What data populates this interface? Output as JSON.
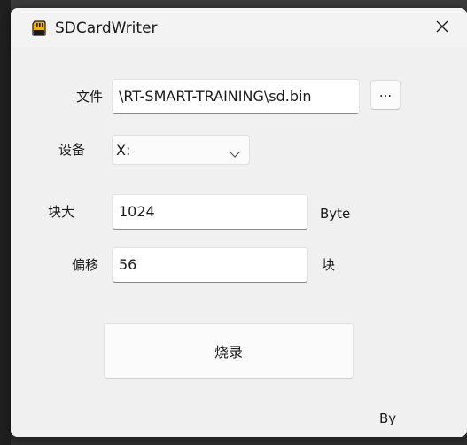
{
  "window": {
    "title": "SDCardWriter",
    "app_icon": "sd-card-icon",
    "close_icon": "close-icon",
    "accent_color": "#f0b400"
  },
  "form": {
    "file_label": "文件",
    "file_value": "\\RT-SMART-TRAINING\\sd.bin",
    "browse_label": "...",
    "device_label": "设备",
    "device_selected": "X:",
    "block_size_label": "块大",
    "block_size_value": "1024",
    "block_size_unit": "Byte",
    "offset_label": "偏移",
    "offset_value": "56",
    "offset_unit": "块"
  },
  "actions": {
    "burn_label": "烧录"
  },
  "footer": {
    "by_label": "By"
  }
}
